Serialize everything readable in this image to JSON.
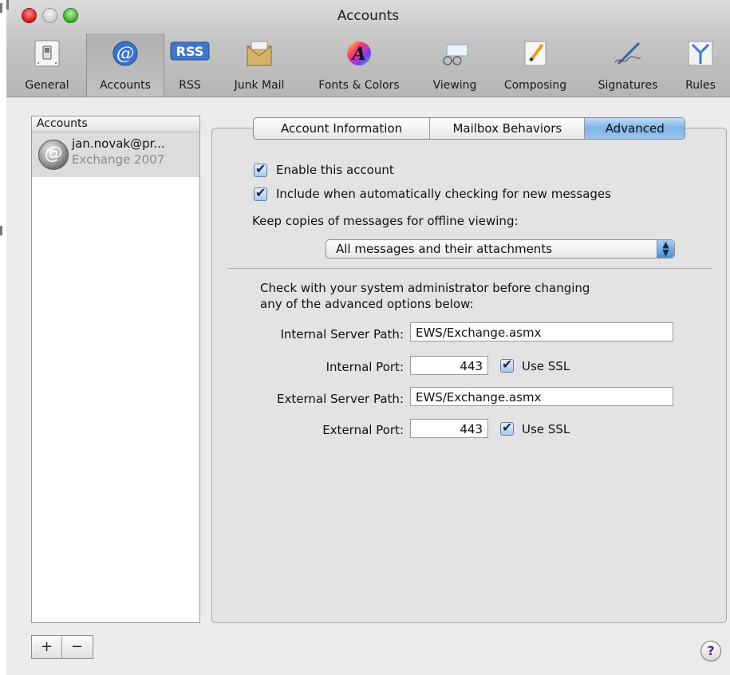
{
  "window": {
    "title": "Accounts"
  },
  "toolbar": {
    "items": [
      {
        "label": "General",
        "icon": "switch-icon"
      },
      {
        "label": "Accounts",
        "icon": "at-sign-icon"
      },
      {
        "label": "RSS",
        "icon": "rss-icon"
      },
      {
        "label": "Junk Mail",
        "icon": "junk-mail-icon"
      },
      {
        "label": "Fonts & Colors",
        "icon": "color-wheel-icon"
      },
      {
        "label": "Viewing",
        "icon": "glasses-icon"
      },
      {
        "label": "Composing",
        "icon": "pencil-icon"
      },
      {
        "label": "Signatures",
        "icon": "pen-signature-icon"
      },
      {
        "label": "Rules",
        "icon": "rules-arrows-icon"
      }
    ],
    "selected": "Accounts"
  },
  "sidebar": {
    "header": "Accounts",
    "accounts": [
      {
        "email": "jan.novak@pr...",
        "type": "Exchange 2007"
      }
    ],
    "add_label": "+",
    "remove_label": "−"
  },
  "tabs": {
    "items": [
      "Account Information",
      "Mailbox Behaviors",
      "Advanced"
    ],
    "selected": "Advanced"
  },
  "advanced": {
    "enable_account": {
      "label": "Enable this account",
      "checked": true
    },
    "include_checking": {
      "label": "Include when automatically checking for new messages",
      "checked": true
    },
    "keep_copies_label": "Keep copies of messages for offline viewing:",
    "keep_copies_value": "All messages and their attachments",
    "admin_note_line1": "Check with your system administrator before changing",
    "admin_note_line2": "any of the advanced options below:",
    "internal_path_label": "Internal Server Path:",
    "internal_path_value": "EWS/Exchange.asmx",
    "internal_port_label": "Internal Port:",
    "internal_port_value": "443",
    "internal_ssl": {
      "label": "Use SSL",
      "checked": true
    },
    "external_path_label": "External Server Path:",
    "external_path_value": "EWS/Exchange.asmx",
    "external_port_label": "External Port:",
    "external_port_value": "443",
    "external_ssl": {
      "label": "Use SSL",
      "checked": true
    }
  },
  "help": {
    "label": "?"
  },
  "colors": {
    "selected_tab": "#7fb3e6",
    "close_button": "#d11a1a",
    "zoom_button": "#3ea82a"
  }
}
